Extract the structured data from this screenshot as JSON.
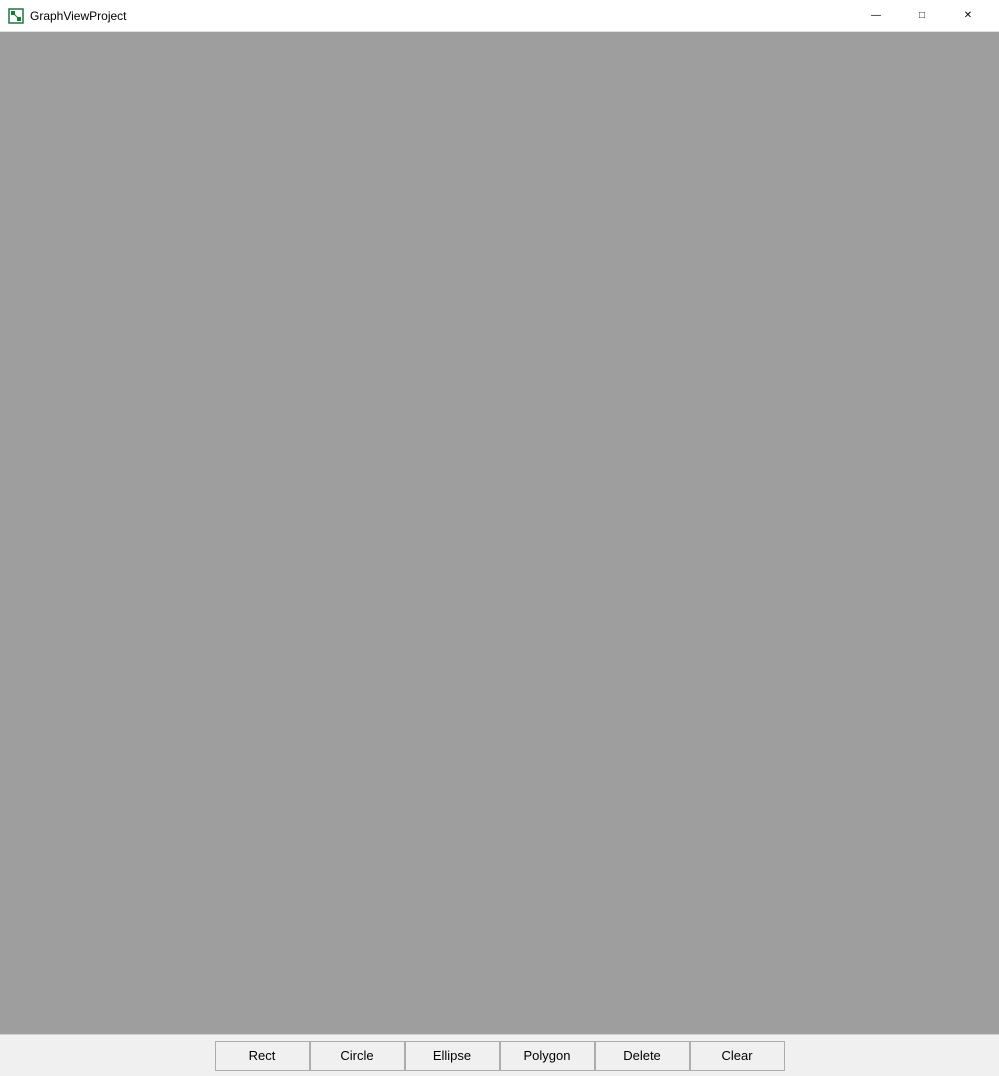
{
  "titlebar": {
    "title": "GraphViewProject",
    "icon": "app-icon"
  },
  "window_controls": {
    "minimize_label": "—",
    "maximize_label": "□",
    "close_label": "✕"
  },
  "toolbar": {
    "buttons": [
      {
        "id": "rect",
        "label": "Rect"
      },
      {
        "id": "circle",
        "label": "Circle"
      },
      {
        "id": "ellipse",
        "label": "Ellipse"
      },
      {
        "id": "polygon",
        "label": "Polygon"
      },
      {
        "id": "delete",
        "label": "Delete"
      },
      {
        "id": "clear",
        "label": "Clear"
      }
    ]
  }
}
